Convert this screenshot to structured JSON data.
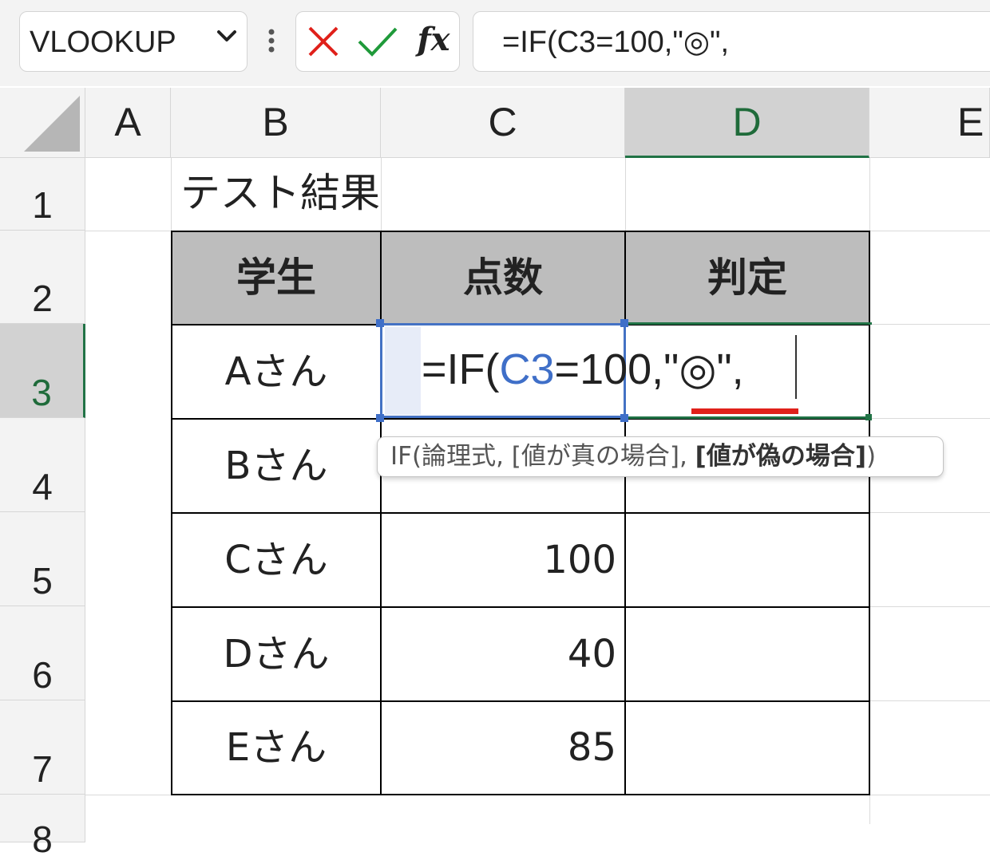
{
  "formula_bar": {
    "name_box": "VLOOKUP",
    "fx_label": "fx",
    "formula": "=IF(C3=100,\"◎\","
  },
  "columns": [
    "A",
    "B",
    "C",
    "D",
    "E"
  ],
  "selected_column": "D",
  "rows": [
    "1",
    "2",
    "3",
    "4",
    "5",
    "6",
    "7",
    "8"
  ],
  "selected_row": "3",
  "sheet": {
    "title": "テスト結果",
    "table_headers": [
      "学生",
      "点数",
      "判定"
    ],
    "table_rows": [
      {
        "student": "Aさん",
        "score": "",
        "judgement": ""
      },
      {
        "student": "Bさん",
        "score": "",
        "judgement": ""
      },
      {
        "student": "Cさん",
        "score": "100",
        "judgement": ""
      },
      {
        "student": "Dさん",
        "score": "40",
        "judgement": ""
      },
      {
        "student": "Eさん",
        "score": "85",
        "judgement": ""
      }
    ]
  },
  "editing_cell": {
    "address": "C3",
    "prefix": "=IF(",
    "reference": "C3",
    "suffix": "=100,\"◎\","
  },
  "tooltip": {
    "prefix": "IF(論理式, [値が真の場合], ",
    "current_arg": "[値が偽の場合]",
    "suffix": ")"
  },
  "colors": {
    "excel_green": "#217346",
    "reference_blue": "#3f6fc8",
    "error_underline_red": "#e0201a",
    "table_header_gray": "#bdbdbd"
  },
  "icons": [
    "chevron-down-icon",
    "more-vertical-icon",
    "cancel-x-icon",
    "enter-check-icon",
    "fx-icon"
  ]
}
